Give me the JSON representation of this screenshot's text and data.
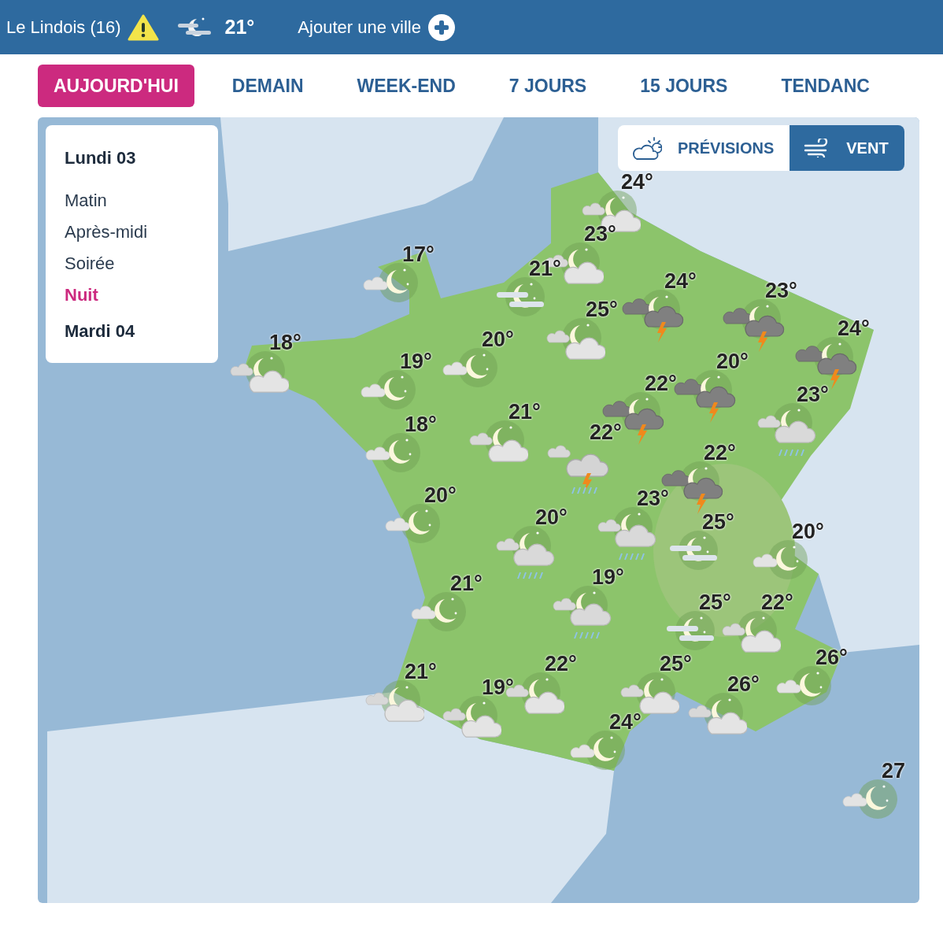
{
  "header": {
    "city": "Le Lindois (16)",
    "temperature": "21°",
    "add_city": "Ajouter une ville"
  },
  "tabs": [
    {
      "label": "AUJOURD'HUI",
      "selected": true
    },
    {
      "label": "DEMAIN",
      "selected": false
    },
    {
      "label": "WEEK-END",
      "selected": false
    },
    {
      "label": "7 JOURS",
      "selected": false
    },
    {
      "label": "15 JOURS",
      "selected": false
    },
    {
      "label": "TENDANC",
      "selected": false
    }
  ],
  "periods": [
    {
      "label": "Lundi 03",
      "kind": "day",
      "selected": false
    },
    {
      "label": "Matin",
      "kind": "period",
      "selected": false
    },
    {
      "label": "Après-midi",
      "kind": "period",
      "selected": false
    },
    {
      "label": "Soirée",
      "kind": "period",
      "selected": false
    },
    {
      "label": "Nuit",
      "kind": "period",
      "selected": true
    },
    {
      "label": "Mardi 04",
      "kind": "day",
      "selected": false
    }
  ],
  "view_toggle": [
    {
      "label": "PRÉVISIONS",
      "kind": "forecast",
      "selected": false
    },
    {
      "label": "VENT",
      "kind": "wind",
      "selected": true
    }
  ],
  "map_markers": [
    {
      "temperature": "24°",
      "kind": "moon-cloud"
    },
    {
      "temperature": "23°",
      "kind": "moon-cloud"
    },
    {
      "temperature": "17°",
      "kind": "moon"
    },
    {
      "temperature": "21°",
      "kind": "moon-fog"
    },
    {
      "temperature": "24°",
      "kind": "storm"
    },
    {
      "temperature": "23°",
      "kind": "storm"
    },
    {
      "temperature": "25°",
      "kind": "moon-cloud"
    },
    {
      "temperature": "24°",
      "kind": "storm"
    },
    {
      "temperature": "18°",
      "kind": "moon-cloud"
    },
    {
      "temperature": "20°",
      "kind": "moon"
    },
    {
      "temperature": "19°",
      "kind": "moon"
    },
    {
      "temperature": "20°",
      "kind": "storm"
    },
    {
      "temperature": "22°",
      "kind": "storm"
    },
    {
      "temperature": "23°",
      "kind": "moon-rain"
    },
    {
      "temperature": "21°",
      "kind": "moon-cloud"
    },
    {
      "temperature": "18°",
      "kind": "moon"
    },
    {
      "temperature": "22°",
      "kind": "storm-rain"
    },
    {
      "temperature": "22°",
      "kind": "storm"
    },
    {
      "temperature": "20°",
      "kind": "moon"
    },
    {
      "temperature": "23°",
      "kind": "moon-rain"
    },
    {
      "temperature": "20°",
      "kind": "moon-rain"
    },
    {
      "temperature": "25°",
      "kind": "moon-fog"
    },
    {
      "temperature": "20°",
      "kind": "moon"
    },
    {
      "temperature": "19°",
      "kind": "moon-rain"
    },
    {
      "temperature": "21°",
      "kind": "moon"
    },
    {
      "temperature": "25°",
      "kind": "moon-fog"
    },
    {
      "temperature": "22°",
      "kind": "moon-cloud"
    },
    {
      "temperature": "26°",
      "kind": "moon"
    },
    {
      "temperature": "21°",
      "kind": "moon-cloud"
    },
    {
      "temperature": "19°",
      "kind": "moon-cloud"
    },
    {
      "temperature": "22°",
      "kind": "moon-cloud"
    },
    {
      "temperature": "25°",
      "kind": "moon-cloud"
    },
    {
      "temperature": "26°",
      "kind": "moon-cloud"
    },
    {
      "temperature": "24°",
      "kind": "moon"
    },
    {
      "temperature": "27",
      "kind": "moon"
    }
  ]
}
